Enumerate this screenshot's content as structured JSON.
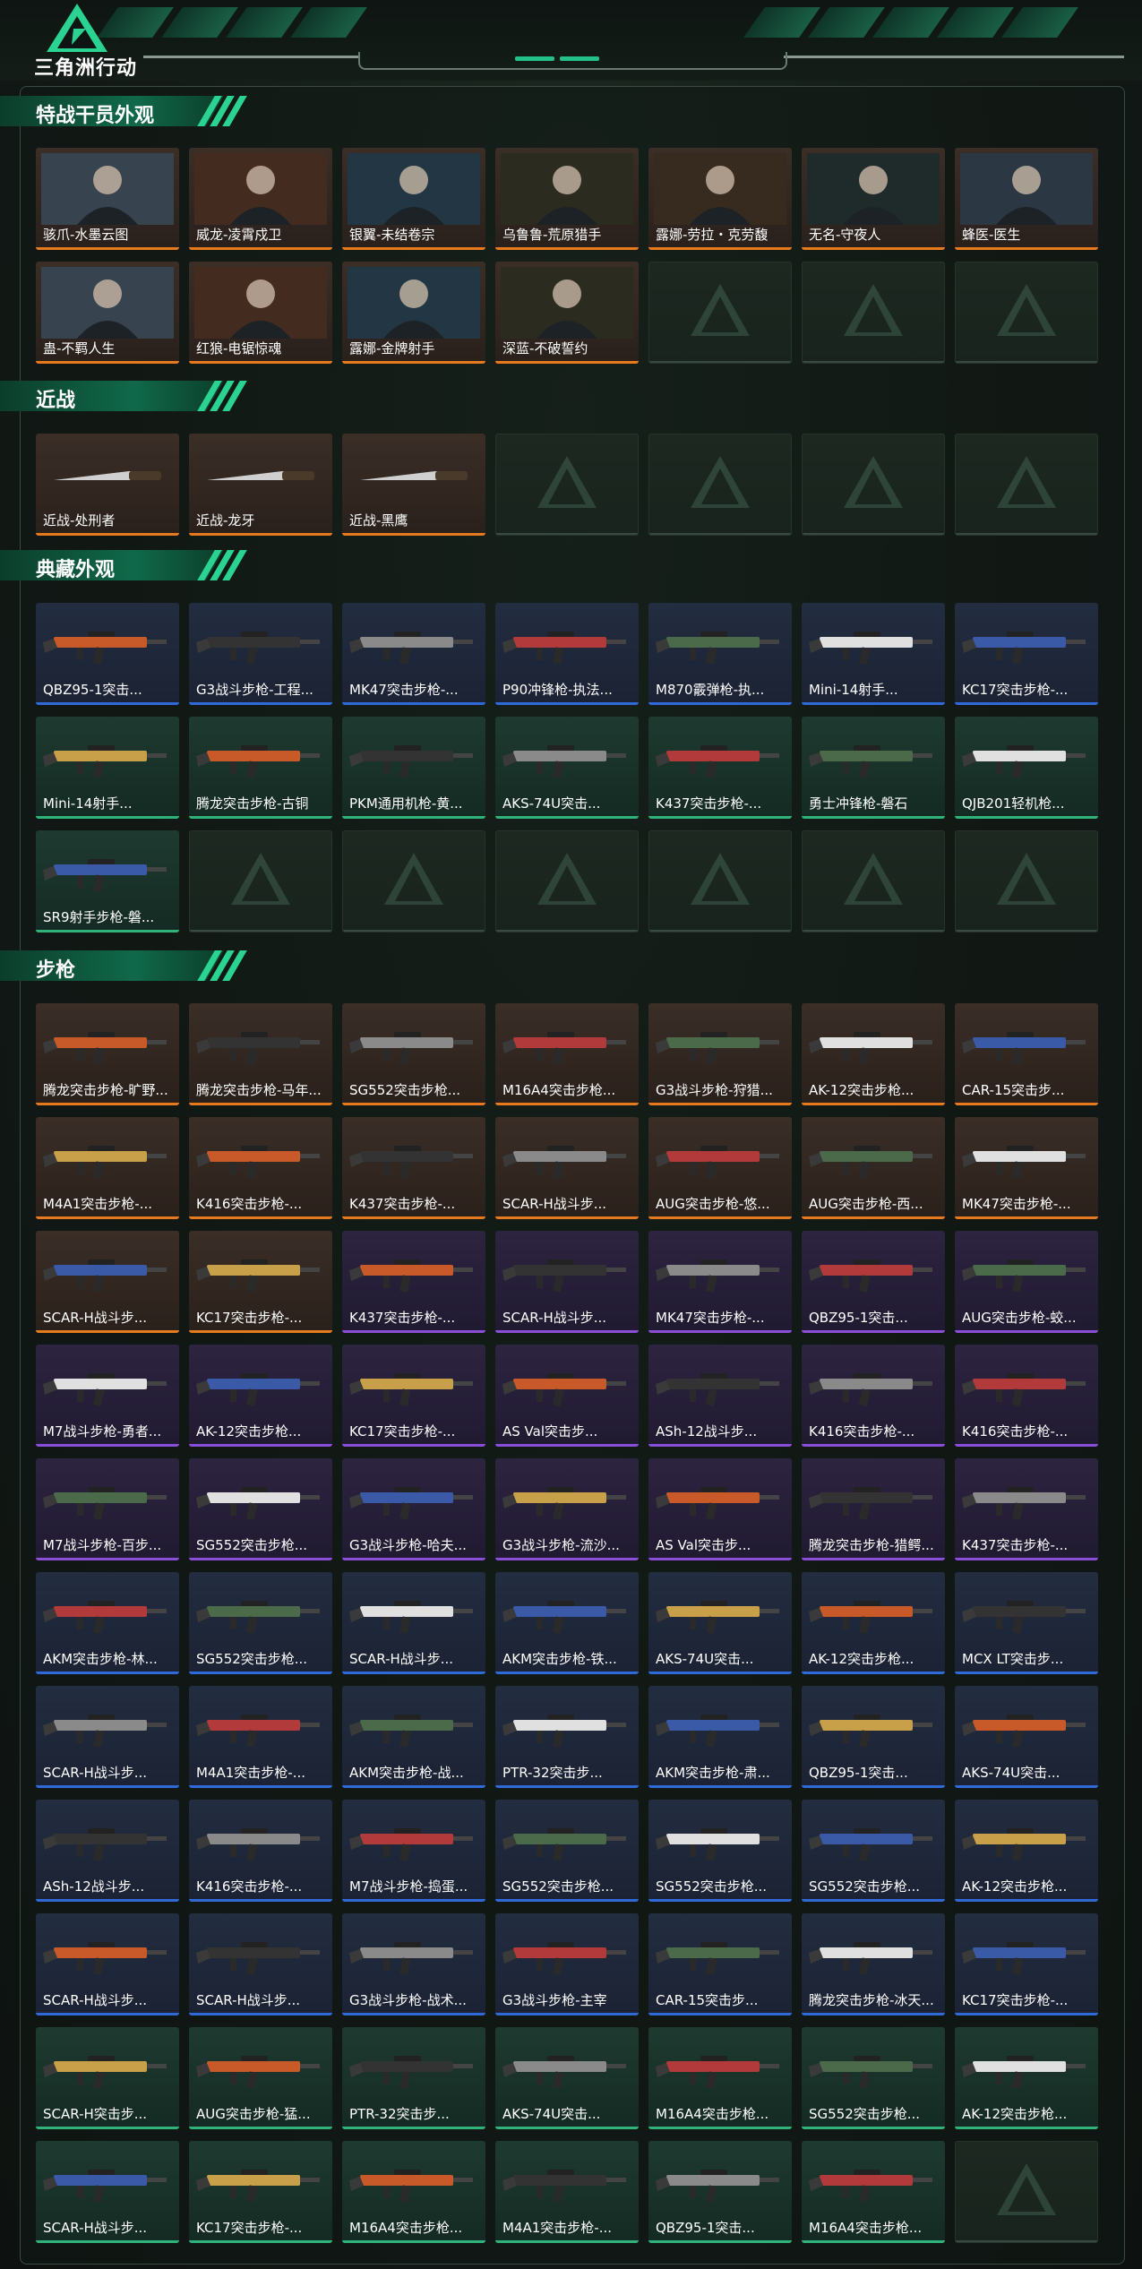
{
  "game": {
    "title": "三角洲行动"
  },
  "theme": {
    "accent": "#2ad392",
    "orange": "#e87a1e",
    "blue": "#2f6ad8",
    "purple": "#8b4ed8",
    "green": "#2fb37a"
  },
  "sections": [
    {
      "title": "特战干员外观",
      "cards": [
        {
          "name": "骇爪-水墨云图",
          "rarity": "orange",
          "kind": "operator"
        },
        {
          "name": "威龙-凌霄戍卫",
          "rarity": "orange",
          "kind": "operator"
        },
        {
          "name": "银翼-未结卷宗",
          "rarity": "orange",
          "kind": "operator"
        },
        {
          "name": "乌鲁鲁-荒原猎手",
          "rarity": "orange",
          "kind": "operator"
        },
        {
          "name": "露娜-劳拉・克劳馥",
          "rarity": "orange",
          "kind": "operator"
        },
        {
          "name": "无名-守夜人",
          "rarity": "orange",
          "kind": "operator"
        },
        {
          "name": "蜂医-医生",
          "rarity": "orange",
          "kind": "operator"
        },
        {
          "name": "蛊-不羁人生",
          "rarity": "orange",
          "kind": "operator"
        },
        {
          "name": "红狼-电锯惊魂",
          "rarity": "orange",
          "kind": "operator"
        },
        {
          "name": "露娜-金牌射手",
          "rarity": "orange",
          "kind": "operator"
        },
        {
          "name": "深蓝-不破誓约",
          "rarity": "orange",
          "kind": "operator"
        },
        {
          "name": "",
          "rarity": "empty"
        },
        {
          "name": "",
          "rarity": "empty"
        },
        {
          "name": "",
          "rarity": "empty"
        }
      ]
    },
    {
      "title": "近战",
      "cards": [
        {
          "name": "近战-处刑者",
          "rarity": "orange",
          "kind": "melee"
        },
        {
          "name": "近战-龙牙",
          "rarity": "orange",
          "kind": "melee"
        },
        {
          "name": "近战-黑鹰",
          "rarity": "orange",
          "kind": "melee"
        },
        {
          "name": "",
          "rarity": "empty"
        },
        {
          "name": "",
          "rarity": "empty"
        },
        {
          "name": "",
          "rarity": "empty"
        },
        {
          "name": "",
          "rarity": "empty"
        }
      ]
    },
    {
      "title": "典藏外观",
      "cards": [
        {
          "name": "QBZ95-1突击...",
          "rarity": "blue",
          "kind": "gun"
        },
        {
          "name": "G3战斗步枪-工程...",
          "rarity": "blue",
          "kind": "gun"
        },
        {
          "name": "MK47突击步枪-...",
          "rarity": "blue",
          "kind": "gun"
        },
        {
          "name": "P90冲锋枪-执法...",
          "rarity": "blue",
          "kind": "gun"
        },
        {
          "name": "M870霰弹枪-执...",
          "rarity": "blue",
          "kind": "gun"
        },
        {
          "name": "Mini-14射手...",
          "rarity": "blue",
          "kind": "gun"
        },
        {
          "name": "KC17突击步枪-...",
          "rarity": "blue",
          "kind": "gun"
        },
        {
          "name": "Mini-14射手...",
          "rarity": "green",
          "kind": "gun"
        },
        {
          "name": "腾龙突击步枪-古铜",
          "rarity": "green",
          "kind": "gun"
        },
        {
          "name": "PKM通用机枪-黄...",
          "rarity": "green",
          "kind": "gun"
        },
        {
          "name": "AKS-74U突击...",
          "rarity": "green",
          "kind": "gun"
        },
        {
          "name": "K437突击步枪-...",
          "rarity": "green",
          "kind": "gun"
        },
        {
          "name": "勇士冲锋枪-磐石",
          "rarity": "green",
          "kind": "gun"
        },
        {
          "name": "QJB201轻机枪...",
          "rarity": "green",
          "kind": "gun"
        },
        {
          "name": "SR9射手步枪-磐...",
          "rarity": "green",
          "kind": "gun"
        },
        {
          "name": "",
          "rarity": "empty"
        },
        {
          "name": "",
          "rarity": "empty"
        },
        {
          "name": "",
          "rarity": "empty"
        },
        {
          "name": "",
          "rarity": "empty"
        },
        {
          "name": "",
          "rarity": "empty"
        },
        {
          "name": "",
          "rarity": "empty"
        }
      ]
    },
    {
      "title": "步枪",
      "cards": [
        {
          "name": "腾龙突击步枪-旷野...",
          "rarity": "orange",
          "kind": "gun"
        },
        {
          "name": "腾龙突击步枪-马年...",
          "rarity": "orange",
          "kind": "gun"
        },
        {
          "name": "SG552突击步枪...",
          "rarity": "orange",
          "kind": "gun"
        },
        {
          "name": "M16A4突击步枪...",
          "rarity": "orange",
          "kind": "gun"
        },
        {
          "name": "G3战斗步枪-狩猎...",
          "rarity": "orange",
          "kind": "gun"
        },
        {
          "name": "AK-12突击步枪...",
          "rarity": "orange",
          "kind": "gun"
        },
        {
          "name": "CAR-15突击步...",
          "rarity": "orange",
          "kind": "gun"
        },
        {
          "name": "M4A1突击步枪-...",
          "rarity": "orange",
          "kind": "gun"
        },
        {
          "name": "K416突击步枪-...",
          "rarity": "orange",
          "kind": "gun"
        },
        {
          "name": "K437突击步枪-...",
          "rarity": "orange",
          "kind": "gun"
        },
        {
          "name": "SCAR-H战斗步...",
          "rarity": "orange",
          "kind": "gun"
        },
        {
          "name": "AUG突击步枪-悠...",
          "rarity": "orange",
          "kind": "gun"
        },
        {
          "name": "AUG突击步枪-西...",
          "rarity": "orange",
          "kind": "gun"
        },
        {
          "name": "MK47突击步枪-...",
          "rarity": "orange",
          "kind": "gun"
        },
        {
          "name": "SCAR-H战斗步...",
          "rarity": "orange",
          "kind": "gun"
        },
        {
          "name": "KC17突击步枪-...",
          "rarity": "orange",
          "kind": "gun"
        },
        {
          "name": "K437突击步枪-...",
          "rarity": "purple",
          "kind": "gun"
        },
        {
          "name": "SCAR-H战斗步...",
          "rarity": "purple",
          "kind": "gun"
        },
        {
          "name": "MK47突击步枪-...",
          "rarity": "purple",
          "kind": "gun"
        },
        {
          "name": "QBZ95-1突击...",
          "rarity": "purple",
          "kind": "gun"
        },
        {
          "name": "AUG突击步枪-蛟...",
          "rarity": "purple",
          "kind": "gun"
        },
        {
          "name": "M7战斗步枪-勇者...",
          "rarity": "purple",
          "kind": "gun"
        },
        {
          "name": "AK-12突击步枪...",
          "rarity": "purple",
          "kind": "gun"
        },
        {
          "name": "KC17突击步枪-...",
          "rarity": "purple",
          "kind": "gun"
        },
        {
          "name": "AS Val突击步...",
          "rarity": "purple",
          "kind": "gun"
        },
        {
          "name": "ASh-12战斗步...",
          "rarity": "purple",
          "kind": "gun"
        },
        {
          "name": "K416突击步枪-...",
          "rarity": "purple",
          "kind": "gun"
        },
        {
          "name": "K416突击步枪-...",
          "rarity": "purple",
          "kind": "gun"
        },
        {
          "name": "M7战斗步枪-百步...",
          "rarity": "purple",
          "kind": "gun"
        },
        {
          "name": "SG552突击步枪...",
          "rarity": "purple",
          "kind": "gun"
        },
        {
          "name": "G3战斗步枪-哈夫...",
          "rarity": "purple",
          "kind": "gun"
        },
        {
          "name": "G3战斗步枪-流沙...",
          "rarity": "purple",
          "kind": "gun"
        },
        {
          "name": "AS Val突击步...",
          "rarity": "purple",
          "kind": "gun"
        },
        {
          "name": "腾龙突击步枪-猎鳄...",
          "rarity": "purple",
          "kind": "gun"
        },
        {
          "name": "K437突击步枪-...",
          "rarity": "purple",
          "kind": "gun"
        },
        {
          "name": "AKM突击步枪-林...",
          "rarity": "blue",
          "kind": "gun"
        },
        {
          "name": "SG552突击步枪...",
          "rarity": "blue",
          "kind": "gun"
        },
        {
          "name": "SCAR-H战斗步...",
          "rarity": "blue",
          "kind": "gun"
        },
        {
          "name": "AKM突击步枪-铁...",
          "rarity": "blue",
          "kind": "gun"
        },
        {
          "name": "AKS-74U突击...",
          "rarity": "blue",
          "kind": "gun"
        },
        {
          "name": "AK-12突击步枪...",
          "rarity": "blue",
          "kind": "gun"
        },
        {
          "name": "MCX LT突击步...",
          "rarity": "blue",
          "kind": "gun"
        },
        {
          "name": "SCAR-H战斗步...",
          "rarity": "blue",
          "kind": "gun"
        },
        {
          "name": "M4A1突击步枪-...",
          "rarity": "blue",
          "kind": "gun"
        },
        {
          "name": "AKM突击步枪-战...",
          "rarity": "blue",
          "kind": "gun"
        },
        {
          "name": "PTR-32突击步...",
          "rarity": "blue",
          "kind": "gun"
        },
        {
          "name": "AKM突击步枪-肃...",
          "rarity": "blue",
          "kind": "gun"
        },
        {
          "name": "QBZ95-1突击...",
          "rarity": "blue",
          "kind": "gun"
        },
        {
          "name": "AKS-74U突击...",
          "rarity": "blue",
          "kind": "gun"
        },
        {
          "name": "ASh-12战斗步...",
          "rarity": "blue",
          "kind": "gun"
        },
        {
          "name": "K416突击步枪-...",
          "rarity": "blue",
          "kind": "gun"
        },
        {
          "name": "M7战斗步枪-捣蛋...",
          "rarity": "blue",
          "kind": "gun"
        },
        {
          "name": "SG552突击步枪...",
          "rarity": "blue",
          "kind": "gun"
        },
        {
          "name": "SG552突击步枪...",
          "rarity": "blue",
          "kind": "gun"
        },
        {
          "name": "SG552突击步枪...",
          "rarity": "blue",
          "kind": "gun"
        },
        {
          "name": "AK-12突击步枪...",
          "rarity": "blue",
          "kind": "gun"
        },
        {
          "name": "SCAR-H战斗步...",
          "rarity": "blue",
          "kind": "gun"
        },
        {
          "name": "SCAR-H战斗步...",
          "rarity": "blue",
          "kind": "gun"
        },
        {
          "name": "G3战斗步枪-战术...",
          "rarity": "blue",
          "kind": "gun"
        },
        {
          "name": "G3战斗步枪-主宰",
          "rarity": "blue",
          "kind": "gun"
        },
        {
          "name": "CAR-15突击步...",
          "rarity": "blue",
          "kind": "gun"
        },
        {
          "name": "腾龙突击步枪-冰天...",
          "rarity": "blue",
          "kind": "gun"
        },
        {
          "name": "KC17突击步枪-...",
          "rarity": "blue",
          "kind": "gun"
        },
        {
          "name": "SCAR-H突击步...",
          "rarity": "green",
          "kind": "gun"
        },
        {
          "name": "AUG突击步枪-猛...",
          "rarity": "green",
          "kind": "gun"
        },
        {
          "name": "PTR-32突击步...",
          "rarity": "green",
          "kind": "gun"
        },
        {
          "name": "AKS-74U突击...",
          "rarity": "green",
          "kind": "gun"
        },
        {
          "name": "M16A4突击步枪...",
          "rarity": "green",
          "kind": "gun"
        },
        {
          "name": "SG552突击步枪...",
          "rarity": "green",
          "kind": "gun"
        },
        {
          "name": "AK-12突击步枪...",
          "rarity": "green",
          "kind": "gun"
        },
        {
          "name": "SCAR-H战斗步...",
          "rarity": "green",
          "kind": "gun"
        },
        {
          "name": "KC17突击步枪-...",
          "rarity": "green",
          "kind": "gun"
        },
        {
          "name": "M16A4突击步枪...",
          "rarity": "green",
          "kind": "gun"
        },
        {
          "name": "M4A1突击步枪-...",
          "rarity": "green",
          "kind": "gun"
        },
        {
          "name": "QBZ95-1突击...",
          "rarity": "green",
          "kind": "gun"
        },
        {
          "name": "M16A4突击步枪...",
          "rarity": "green",
          "kind": "gun"
        },
        {
          "name": "",
          "rarity": "empty"
        }
      ]
    }
  ]
}
